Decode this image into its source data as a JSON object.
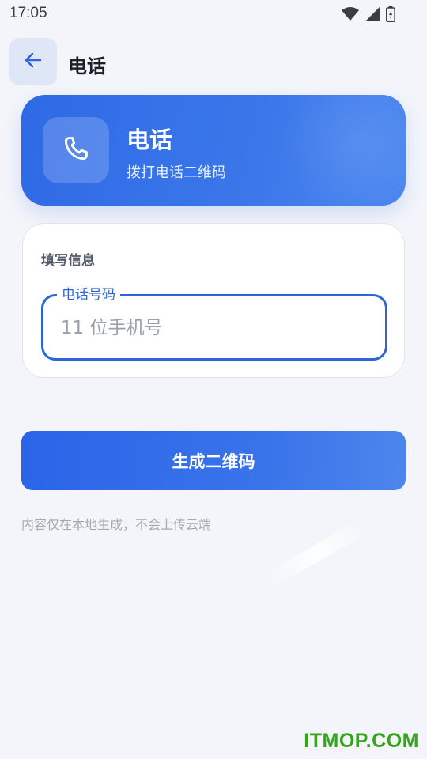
{
  "status_bar": {
    "time": "17:05",
    "icons": [
      "wifi-icon",
      "signal-icon",
      "battery-icon"
    ]
  },
  "app_bar": {
    "back_icon": "arrow-left-icon",
    "title": "电话"
  },
  "hero": {
    "icon": "phone-icon",
    "title": "电话",
    "subtitle": "拨打电话二维码"
  },
  "form": {
    "section_label": "填写信息",
    "phone_field": {
      "label": "电话号码",
      "value": "",
      "placeholder": "11 位手机号"
    }
  },
  "generate_button": {
    "label": "生成二维码"
  },
  "hint": "内容仅在本地生成，不会上传云端",
  "watermark": "ITMOP.COM",
  "colors": {
    "accent": "#2e64d6",
    "hero_bg": "#3474e8",
    "page_bg": "#f3f5fa",
    "watermark": "#37a51c"
  }
}
